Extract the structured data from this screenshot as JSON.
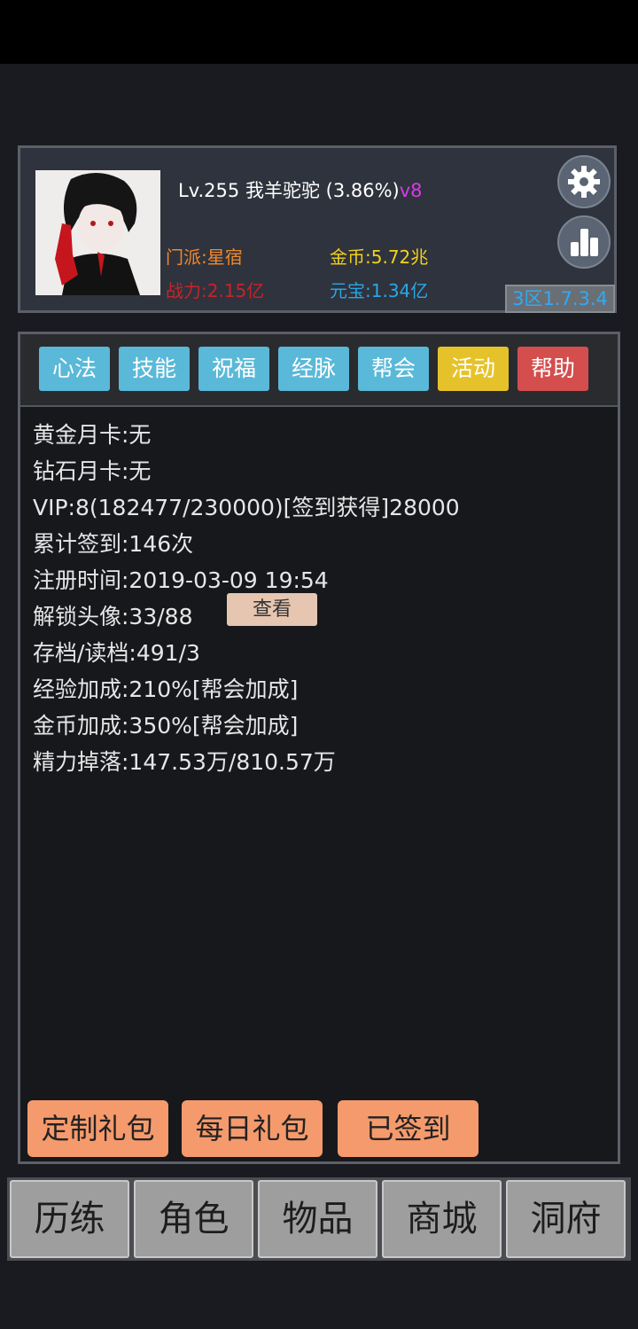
{
  "profile": {
    "level": "Lv.255",
    "name": "我羊驼驼",
    "progress": "(3.86%)",
    "vip": "v8",
    "sect": "门派:星宿",
    "power": "战力:2.15亿",
    "gold": "金币:5.72兆",
    "yuanbao": "元宝:1.34亿",
    "server": "3区1.7.3.4"
  },
  "tabs": [
    {
      "label": "心法",
      "color": "#5ab8d8"
    },
    {
      "label": "技能",
      "color": "#5ab8d8"
    },
    {
      "label": "祝福",
      "color": "#5ab8d8"
    },
    {
      "label": "经脉",
      "color": "#5ab8d8"
    },
    {
      "label": "帮会",
      "color": "#5ab8d8"
    },
    {
      "label": "活动",
      "color": "#e6c22a"
    },
    {
      "label": "帮助",
      "color": "#d34e4d"
    }
  ],
  "info": {
    "gold_card": "黄金月卡:无",
    "diamond_card": "钻石月卡:无",
    "vip": "VIP:8(182477/230000)[签到获得]28000",
    "checkin_total": "累计签到:146次",
    "register_time": "注册时间:2019-03-09 19:54",
    "unlocked_avatars": "解锁头像:33/88",
    "view_button": "查看",
    "saves": "存档/读档:491/3",
    "exp_bonus": "经验加成:210%[帮会加成]",
    "gold_bonus": "金币加成:350%[帮会加成]",
    "energy_drop": "精力掉落:147.53万/810.57万"
  },
  "gifts": {
    "custom": "定制礼包",
    "daily": "每日礼包",
    "signed": "已签到"
  },
  "nav": {
    "items": [
      "历练",
      "角色",
      "物品",
      "商城",
      "洞府"
    ]
  }
}
